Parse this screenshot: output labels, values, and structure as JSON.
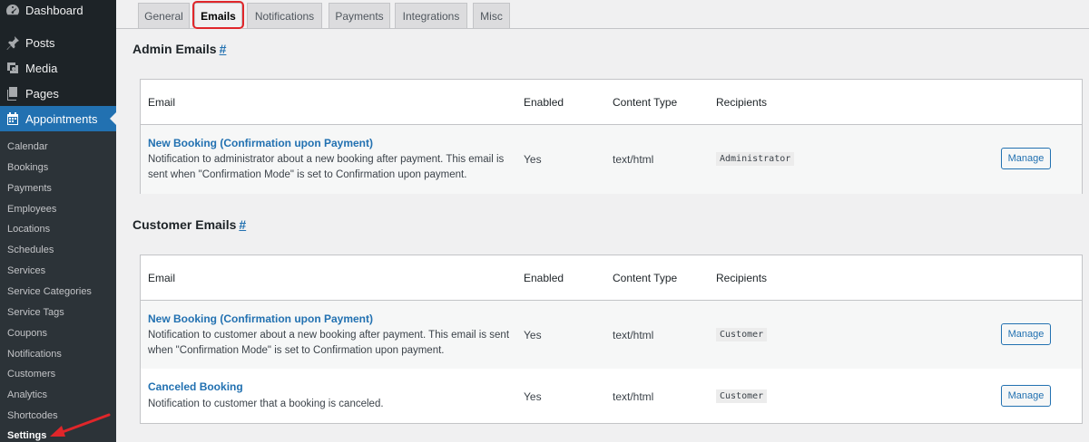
{
  "sidebar": {
    "top_items": [
      {
        "label": "Dashboard",
        "icon": "dashboard-icon"
      },
      {
        "label": "Posts",
        "icon": "pin-icon"
      },
      {
        "label": "Media",
        "icon": "media-icon"
      },
      {
        "label": "Pages",
        "icon": "pages-icon"
      },
      {
        "label": "Appointments",
        "icon": "calendar-icon"
      }
    ],
    "submenu": [
      "Calendar",
      "Bookings",
      "Payments",
      "Employees",
      "Locations",
      "Schedules",
      "Services",
      "Service Categories",
      "Service Tags",
      "Coupons",
      "Notifications",
      "Customers",
      "Analytics",
      "Shortcodes",
      "Settings"
    ]
  },
  "tabs": [
    "General",
    "Emails",
    "Notifications",
    "Payments",
    "Integrations",
    "Misc"
  ],
  "active_tab": "Emails",
  "admin_section": {
    "title": "Admin Emails",
    "hash": "#",
    "headers": {
      "email": "Email",
      "enabled": "Enabled",
      "content_type": "Content Type",
      "recipients": "Recipients"
    },
    "rows": [
      {
        "name": "New Booking (Confirmation upon Payment)",
        "desc_1": "Notification to administrator about a new booking after payment. This email is",
        "desc_2": "sent when \"Confirmation Mode\" is set to Confirmation upon payment.",
        "enabled": "Yes",
        "content_type": "text/html",
        "recipients": "Administrator",
        "action": "Manage"
      }
    ]
  },
  "customer_section": {
    "title": "Customer Emails",
    "hash": "#",
    "headers": {
      "email": "Email",
      "enabled": "Enabled",
      "content_type": "Content Type",
      "recipients": "Recipients"
    },
    "rows": [
      {
        "name": "New Booking (Confirmation upon Payment)",
        "desc_1": "Notification to customer about a new booking after payment. This email is sent",
        "desc_2": "when \"Confirmation Mode\" is set to Confirmation upon payment.",
        "enabled": "Yes",
        "content_type": "text/html",
        "recipients": "Customer",
        "action": "Manage"
      },
      {
        "name": "Canceled Booking",
        "desc_1": "Notification to customer that a booking is canceled.",
        "enabled": "Yes",
        "content_type": "text/html",
        "recipients": "Customer",
        "action": "Manage"
      }
    ]
  },
  "colors": {
    "sidebar_bg": "#1d2327",
    "accent": "#2271b1",
    "annotation": "#e0262a"
  }
}
